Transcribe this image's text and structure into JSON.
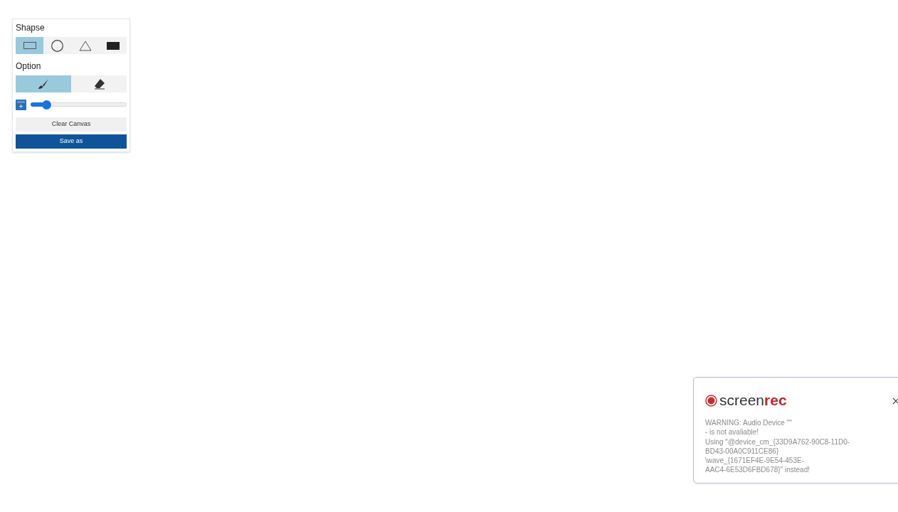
{
  "panel": {
    "shapes_title": "Shapse",
    "shapes": [
      {
        "kind": "rectangle",
        "selected": true
      },
      {
        "kind": "circle",
        "selected": false
      },
      {
        "kind": "triangle",
        "selected": false
      },
      {
        "kind": "filled-rectangle",
        "selected": false
      }
    ],
    "option_title": "Option",
    "tools": [
      {
        "kind": "brush",
        "selected": true
      },
      {
        "kind": "eraser",
        "selected": false
      }
    ],
    "brush_size": {
      "level": 0.16
    },
    "clear_button": "Clear Canvas",
    "save_button": "Save as"
  },
  "notification": {
    "logo": {
      "text": "screen",
      "accent": "rec"
    },
    "message_lines": [
      "WARNING: Audio Device \"\"",
      "- is not avaliable!",
      "Using \"@device_cm_{33D9A762-90C8-11D0-",
      "BD43-00A0C911CE86}",
      "\\wave_{1671EF4E-9E54-453E-",
      "AAC4-6E53D6FBD678}\" instead!"
    ]
  }
}
